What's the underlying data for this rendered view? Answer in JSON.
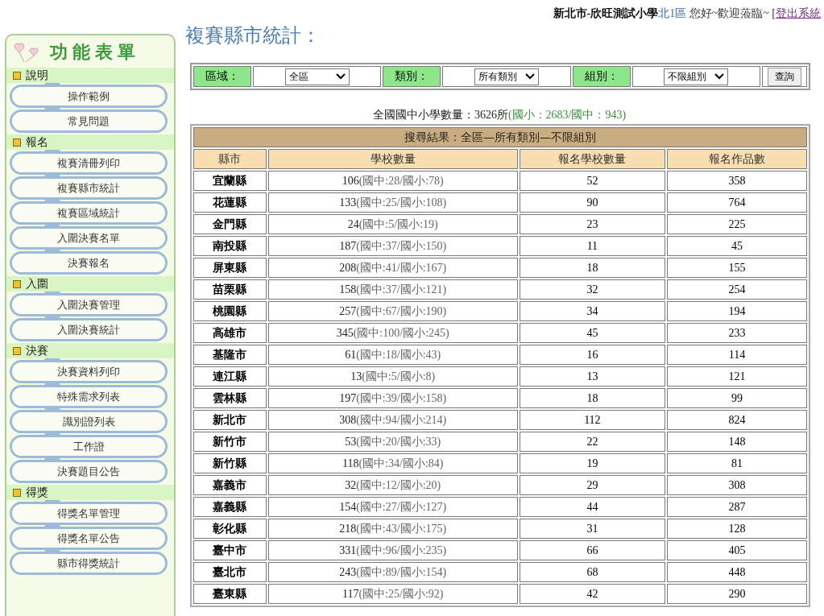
{
  "header": {
    "school": "新北市-欣旺測試小學",
    "district": "北1區",
    "greeting": "您好~歡迎蒞臨~ [",
    "logout": "登出系統"
  },
  "sidebar": {
    "title": "功能表單",
    "sections": [
      {
        "label": "說明",
        "items": [
          "操作範例",
          "常見問題"
        ]
      },
      {
        "label": "報名",
        "items": [
          "複賽清冊列印",
          "複賽縣市統計",
          "複賽區域統計",
          "入圍決賽名單",
          "決賽報名"
        ]
      },
      {
        "label": "入圍",
        "items": [
          "入圍決賽管理",
          "入圍決賽統計"
        ]
      },
      {
        "label": "決賽",
        "items": [
          "決賽資料列印",
          "特殊需求列表",
          "識別證列表",
          "工作證",
          "決賽題目公告"
        ]
      },
      {
        "label": "得獎",
        "items": [
          "得獎名單管理",
          "得獎名單公告",
          "縣市得獎統計"
        ]
      }
    ]
  },
  "page_title": "複賽縣市統計：",
  "filters": [
    {
      "label": "區域：",
      "value": "全區"
    },
    {
      "label": "類別：",
      "value": "所有類別"
    },
    {
      "label": "組別：",
      "value": "不限組別"
    }
  ],
  "query_button": "查詢",
  "summary": {
    "total": "全國國中小學數量：3626所",
    "detail": "(國小：2683/國中：943)"
  },
  "table": {
    "caption": "搜尋結果：全區—所有類別—不限組別",
    "columns": [
      "縣市",
      "學校數量",
      "報名學校數量",
      "報名作品數"
    ],
    "rows": [
      {
        "county": "宜蘭縣",
        "total": "106",
        "breakdown": "(國中:28/國小:78)",
        "registered": "52",
        "works": "358"
      },
      {
        "county": "花蓮縣",
        "total": "133",
        "breakdown": "(國中:25/國小:108)",
        "registered": "90",
        "works": "764"
      },
      {
        "county": "金門縣",
        "total": "24",
        "breakdown": "(國中:5/國小:19)",
        "registered": "23",
        "works": "225"
      },
      {
        "county": "南投縣",
        "total": "187",
        "breakdown": "(國中:37/國小:150)",
        "registered": "11",
        "works": "45"
      },
      {
        "county": "屏東縣",
        "total": "208",
        "breakdown": "(國中:41/國小:167)",
        "registered": "18",
        "works": "155"
      },
      {
        "county": "苗栗縣",
        "total": "158",
        "breakdown": "(國中:37/國小:121)",
        "registered": "32",
        "works": "254"
      },
      {
        "county": "桃園縣",
        "total": "257",
        "breakdown": "(國中:67/國小:190)",
        "registered": "34",
        "works": "194"
      },
      {
        "county": "高雄市",
        "total": "345",
        "breakdown": "(國中:100/國小:245)",
        "registered": "45",
        "works": "233"
      },
      {
        "county": "基隆市",
        "total": "61",
        "breakdown": "(國中:18/國小:43)",
        "registered": "16",
        "works": "114"
      },
      {
        "county": "連江縣",
        "total": "13",
        "breakdown": "(國中:5/國小:8)",
        "registered": "13",
        "works": "121"
      },
      {
        "county": "雲林縣",
        "total": "197",
        "breakdown": "(國中:39/國小:158)",
        "registered": "18",
        "works": "99"
      },
      {
        "county": "新北市",
        "total": "308",
        "breakdown": "(國中:94/國小:214)",
        "registered": "112",
        "works": "824"
      },
      {
        "county": "新竹市",
        "total": "53",
        "breakdown": "(國中:20/國小:33)",
        "registered": "22",
        "works": "148"
      },
      {
        "county": "新竹縣",
        "total": "118",
        "breakdown": "(國中:34/國小:84)",
        "registered": "19",
        "works": "81"
      },
      {
        "county": "嘉義市",
        "total": "32",
        "breakdown": "(國中:12/國小:20)",
        "registered": "29",
        "works": "308"
      },
      {
        "county": "嘉義縣",
        "total": "154",
        "breakdown": "(國中:27/國小:127)",
        "registered": "44",
        "works": "287"
      },
      {
        "county": "彰化縣",
        "total": "218",
        "breakdown": "(國中:43/國小:175)",
        "registered": "31",
        "works": "128"
      },
      {
        "county": "臺中市",
        "total": "331",
        "breakdown": "(國中:96/國小:235)",
        "registered": "66",
        "works": "405"
      },
      {
        "county": "臺北市",
        "total": "243",
        "breakdown": "(國中:89/國小:154)",
        "registered": "68",
        "works": "448"
      },
      {
        "county": "臺東縣",
        "total": "117",
        "breakdown": "(國中:25/國小:92)",
        "registered": "42",
        "works": "290"
      }
    ]
  }
}
